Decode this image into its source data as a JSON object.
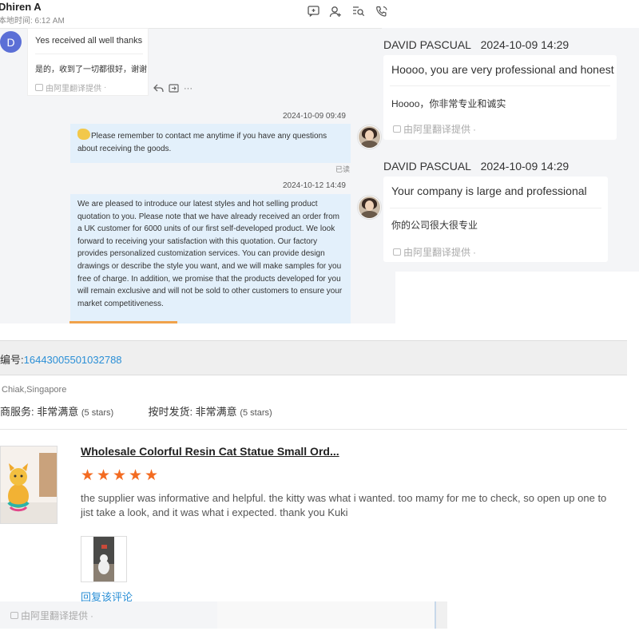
{
  "chat": {
    "contact_name": "Dhiren A",
    "local_time": "本地时间: 6:12 AM",
    "avatar_letter": "D",
    "incoming": {
      "text_en": "Yes received all well thanks",
      "text_zh": "是的，收到了一切都很好，谢谢",
      "powered_by": "由阿里翻译提供",
      "more": "···"
    },
    "messages": [
      {
        "timestamp": "2024-10-09 09:49",
        "text": "Please remember to contact me anytime if you have any questions about receiving the goods.",
        "status": "已读"
      },
      {
        "timestamp": "2024-10-12 14:49",
        "text": "We are pleased to introduce our latest styles and hot selling product quotation to you. Please note that we have already received an order from a UK customer for 6000 units of our first self-developed product. We look forward to receiving your satisfaction with this quotation. Our factory provides personalized customization services. You can provide design drawings or describe the style you want, and we will make samples for you free of charge. In addition, we promise that the products developed for you will remain exclusive and will not be sold to other customers to ensure your market competitiveness."
      }
    ]
  },
  "translations": [
    {
      "sender": "DAVID PASCUAL",
      "timestamp": "2024-10-09 14:29",
      "text_en": "Hoooo, you are very professional and honest",
      "text_zh": "Hoooo，你非常专业和诚实",
      "powered_by": "由阿里翻译提供"
    },
    {
      "sender": "DAVID PASCUAL",
      "timestamp": "2024-10-09 14:29",
      "text_en": "Your company is large and professional",
      "text_zh": "你的公司很大很专业",
      "powered_by": "由阿里翻译提供"
    }
  ],
  "order": {
    "label": "编号:",
    "number": "16443005501032788",
    "buyer_location": "Chiak,Singapore",
    "service_label": "商服务: 非常满意",
    "service_stars": "(5 stars)",
    "delivery_label": "按时发货: 非常满意",
    "delivery_stars": "(5 stars)"
  },
  "review": {
    "product_title": "Wholesale Colorful Resin Cat Statue Small Ord...",
    "rating": 5,
    "text": "the supplier was informative and helpful. the kitty was what i wanted. too mamy for me to check, so open up one to jist take a look, and it was what i expected. thank you Kuki",
    "reply_link": "回复该评论",
    "powered_by": "由阿里翻译提供"
  },
  "colors": {
    "accent_blue": "#2b8fd6",
    "star_orange": "#f36b21",
    "bubble_blue": "#e3f0fb"
  }
}
